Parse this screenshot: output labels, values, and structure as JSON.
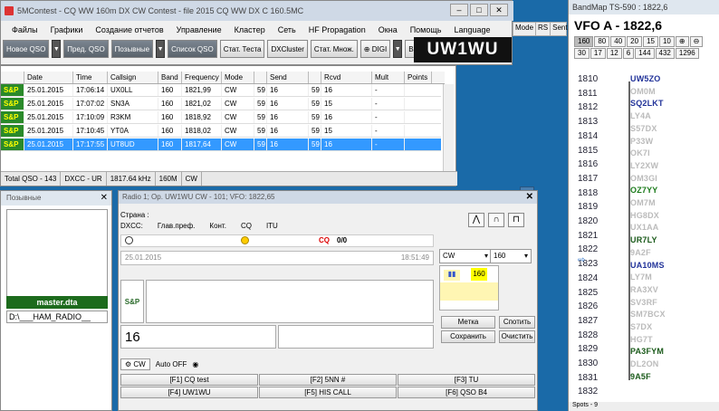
{
  "main": {
    "title": "5MContest - CQ WW 160m DX CW Contest - file 2015 CQ WW DX C 160.5MC",
    "menu": [
      "Файлы",
      "Графики",
      "Создание отчетов",
      "Управление",
      "Кластер",
      "Сеть",
      "HF Propagation",
      "Окна",
      "Помощь",
      "Language"
    ],
    "toolbar": [
      "Новое QSO",
      "Пред. QSO",
      "Позывные",
      "Список QSO",
      "Стат. Теста",
      "DXCluster",
      "Стат. Множ.",
      "DIGI",
      "Band"
    ],
    "callsign": "UW1WU",
    "right_cols": [
      "Mode",
      "RS",
      "Sent"
    ]
  },
  "log": {
    "headers": [
      "",
      "Date",
      "Time",
      "Callsign",
      "Band",
      "Frequency",
      "Mode",
      "",
      "Send",
      "",
      "Rcvd",
      "Mult",
      "Points"
    ],
    "rows": [
      {
        "sp": "S&P",
        "date": "25.01.2015",
        "time": "17:06:14",
        "call": "UX0LL",
        "band": "160",
        "freq": "1821,99",
        "mode": "CW",
        "rs": "59",
        "send": "16",
        "rs2": "59",
        "rcvd": "16",
        "mult": "-"
      },
      {
        "sp": "S&P",
        "date": "25.01.2015",
        "time": "17:07:02",
        "call": "SN3A",
        "band": "160",
        "freq": "1821,02",
        "mode": "CW",
        "rs": "59",
        "send": "16",
        "rs2": "59",
        "rcvd": "15",
        "mult": "-"
      },
      {
        "sp": "S&P",
        "date": "25.01.2015",
        "time": "17:10:09",
        "call": "R3KM",
        "band": "160",
        "freq": "1818,92",
        "mode": "CW",
        "rs": "59",
        "send": "16",
        "rs2": "59",
        "rcvd": "16",
        "mult": "-"
      },
      {
        "sp": "S&P",
        "date": "25.01.2015",
        "time": "17:10:45",
        "call": "YT0A",
        "band": "160",
        "freq": "1818,02",
        "mode": "CW",
        "rs": "59",
        "send": "16",
        "rs2": "59",
        "rcvd": "15",
        "mult": "-"
      },
      {
        "sp": "S&P",
        "date": "25.01.2015",
        "time": "17:17:55",
        "call": "UT8UD",
        "band": "160",
        "freq": "1817,64",
        "mode": "CW",
        "rs": "59",
        "send": "16",
        "rs2": "59",
        "rcvd": "16",
        "mult": "-"
      }
    ],
    "status": [
      "Total QSO - 143",
      "DXCC - UR",
      "1817.64 kHz",
      "160M",
      "CW"
    ]
  },
  "callpanel": {
    "title": "Позывные",
    "master": "master.dta",
    "path": "D:\\___HAM_RADIO__"
  },
  "radio": {
    "title": "Radio 1; Op. UW1WU CW - 101; VFO: 1822,65",
    "country": "Страна :",
    "cols": [
      "DXCC:",
      "Глав.преф.",
      "Конт.",
      "CQ",
      "ITU"
    ],
    "cq": "CQ",
    "cqval": "0/0",
    "date": "25.01.2015",
    "time": "18:51:49",
    "sp": "S&P",
    "rst": "16",
    "mode": "CW",
    "band": "160",
    "band_cell": "160",
    "buttons": [
      "Метка",
      "Спотить",
      "Сохранить",
      "Очистить"
    ],
    "cwtab": "CW",
    "autooff": "Auto OFF",
    "fkeys": [
      "[F1] CQ test",
      "[F2] 5NN #",
      "[F3] TU",
      "[F4] UW1WU",
      "[F5] HIS CALL",
      "[F6] QSO B4"
    ]
  },
  "bandmap": {
    "title": "BandMap TS-590 : 1822,6",
    "vfo": "VFO A - 1822,6",
    "btns": [
      "160",
      "80",
      "40",
      "20",
      "15",
      "10",
      "⊕",
      "⊖",
      "30",
      "17",
      "12",
      "6",
      "144",
      "432",
      "1296"
    ],
    "freqs": [
      "1810",
      "1811",
      "1812",
      "1813",
      "1814",
      "1815",
      "1816",
      "1817",
      "1818",
      "1819",
      "1820",
      "1821",
      "1822",
      "1823",
      "1824",
      "1825",
      "1826",
      "1827",
      "1828",
      "1829",
      "1830",
      "1831",
      "1832"
    ],
    "spots": [
      {
        "call": "UW5ZO",
        "color": "#223399"
      },
      {
        "call": "OM0M",
        "color": "#bbbbbb"
      },
      {
        "call": "SQ2LKT",
        "color": "#223399"
      },
      {
        "call": "LY4A",
        "color": "#bbbbbb"
      },
      {
        "call": "S57DX",
        "color": "#bbbbbb"
      },
      {
        "call": "P33W",
        "color": "#bbbbbb"
      },
      {
        "call": "OK7I",
        "color": "#bbbbbb"
      },
      {
        "call": "LY2XW",
        "color": "#bbbbbb"
      },
      {
        "call": "OM3GI",
        "color": "#bbbbbb"
      },
      {
        "call": "OZ7YY",
        "color": "#1a7a1a"
      },
      {
        "call": "OM7M",
        "color": "#bbbbbb"
      },
      {
        "call": "HG8DX",
        "color": "#bbbbbb"
      },
      {
        "call": "UX1AA",
        "color": "#bbbbbb"
      },
      {
        "call": "UR7LY",
        "color": "#1a5a1a"
      },
      {
        "call": "9A2F",
        "color": "#bbbbbb"
      },
      {
        "call": "UA10MS",
        "color": "#223399"
      },
      {
        "call": "LY7M",
        "color": "#bbbbbb"
      },
      {
        "call": "RA3XV",
        "color": "#bbbbbb"
      },
      {
        "call": "SV3RF",
        "color": "#bbbbbb"
      },
      {
        "call": "SM7BCX",
        "color": "#bbbbbb"
      },
      {
        "call": "S7DX",
        "color": "#bbbbbb"
      },
      {
        "call": "HG7T",
        "color": "#bbbbbb"
      },
      {
        "call": "PA3FYM",
        "color": "#1a5a1a"
      },
      {
        "call": "DL2ON",
        "color": "#bbbbbb"
      },
      {
        "call": "9A5F",
        "color": "#1a5a1a"
      }
    ],
    "footer": "Spots - 9"
  }
}
